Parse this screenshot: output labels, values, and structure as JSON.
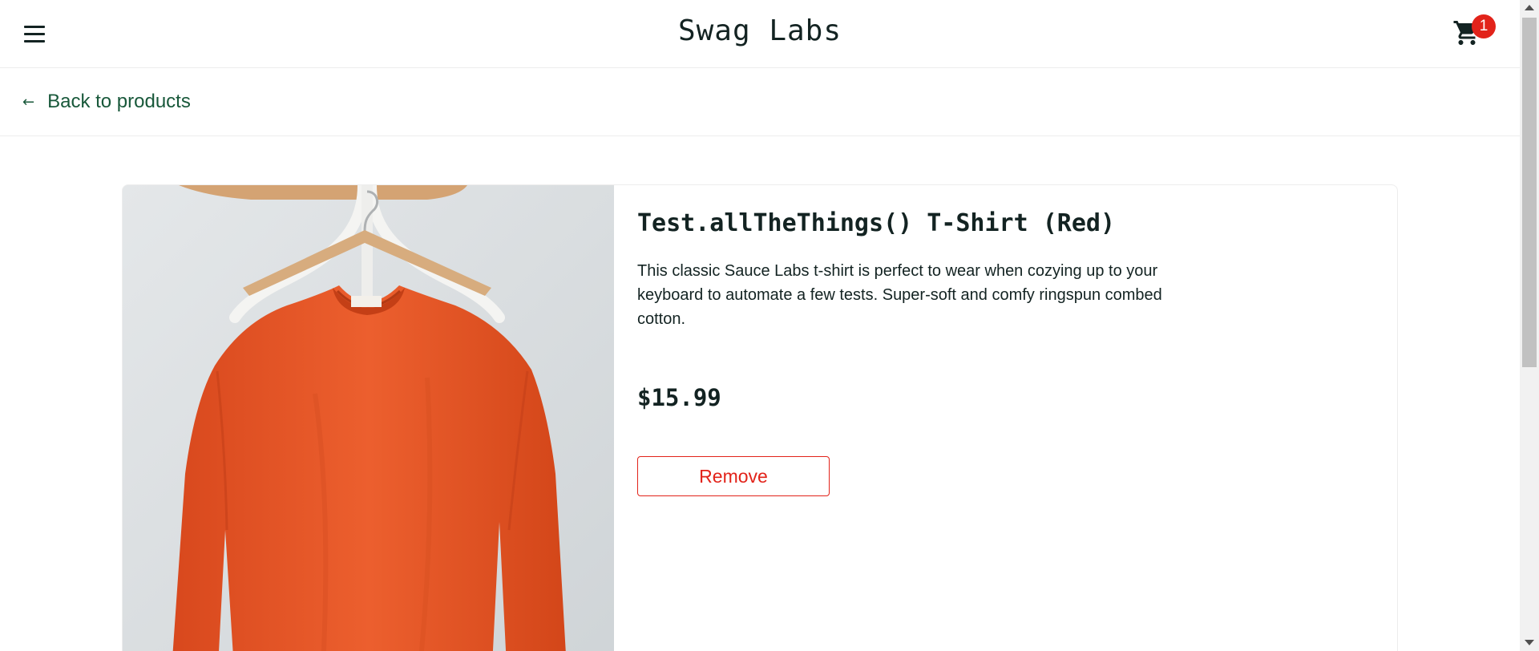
{
  "header": {
    "logo": "Swag Labs",
    "cart_count": "1",
    "menu_icon": "hamburger-menu-icon",
    "cart_icon": "shopping-cart-icon"
  },
  "subheader": {
    "back_label": "Back to products",
    "back_icon": "arrow-left-icon"
  },
  "product": {
    "name": "Test.allTheThings() T-Shirt (Red)",
    "description": "This classic Sauce Labs t-shirt is perfect to wear when cozying up to your keyboard to automate a few tests. Super-soft and comfy ringspun combed cotton.",
    "price": "$15.99",
    "action_label": "Remove"
  },
  "colors": {
    "accent": "#18583a",
    "danger": "#e2231a",
    "text": "#132322",
    "shirt": "#e5572a"
  }
}
